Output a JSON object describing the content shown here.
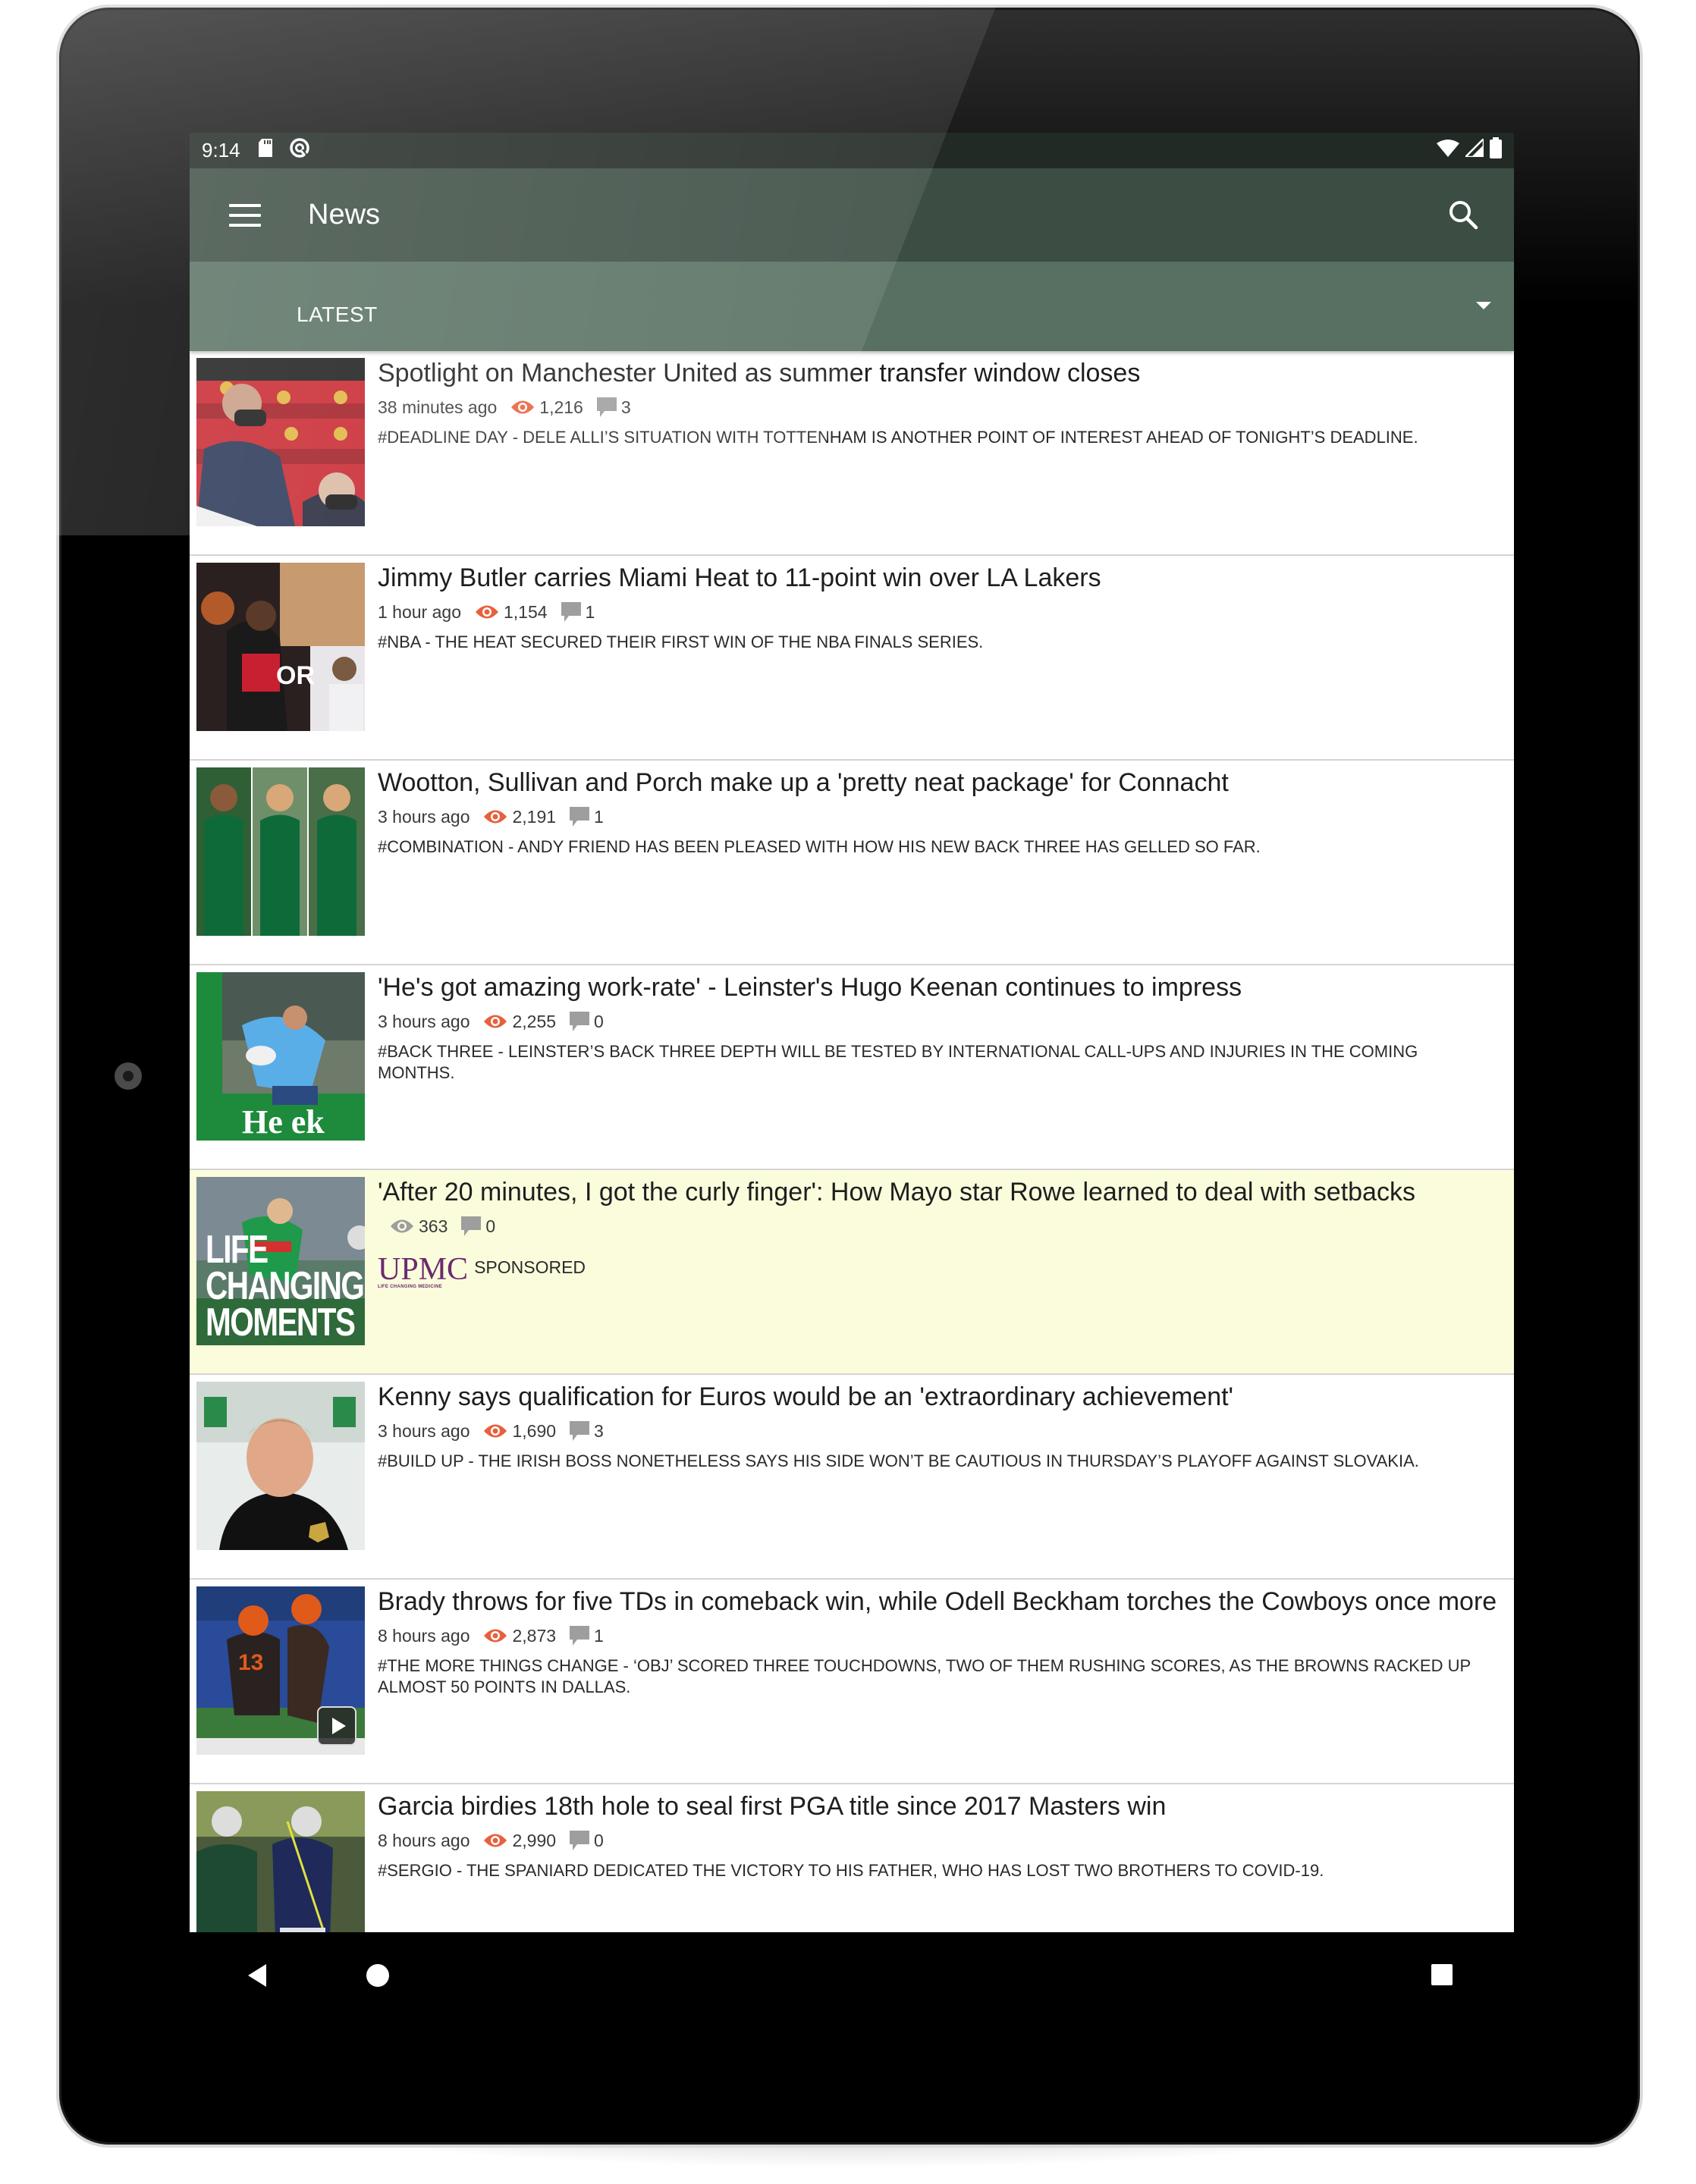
{
  "status_bar": {
    "time": "9:14",
    "left_icons": [
      "sd-card-icon",
      "data-saver-icon"
    ],
    "right_icons": [
      "wifi-icon",
      "cell-signal-icon",
      "battery-icon"
    ]
  },
  "toolbar": {
    "title": "News",
    "menu_icon": "hamburger-menu-icon",
    "search_icon": "search-icon"
  },
  "tab_strip": {
    "selected": "LATEST",
    "dropdown_icon": "dropdown-arrow-icon"
  },
  "colors": {
    "status_bar": "#222a25",
    "toolbar": "#3c4d43",
    "tab_strip": "#577061",
    "views_icon": "#e8603c",
    "comments_icon": "#9e9e9e",
    "sponsored_bg": "#fafcdc",
    "sponsor_brand": "#6b2a6e"
  },
  "articles": [
    {
      "headline": "Spotlight on Manchester United as summer transfer window closes",
      "time_ago": "38 minutes ago",
      "views": "1,216",
      "comments": "3",
      "tagline": "#DEADLINE DAY - DELE ALLI’S SITUATION WITH TOTTENHAM IS ANOTHER POINT OF INTEREST AHEAD OF TONIGHT’S DEADLINE.",
      "thumbnail": "man-utd-executives-in-stands-photo"
    },
    {
      "headline": "Jimmy Butler carries Miami Heat to 11-point win over LA Lakers",
      "time_ago": "1 hour ago",
      "views": "1,154",
      "comments": "1",
      "tagline": "#NBA - THE HEAT SECURED THEIR FIRST WIN OF THE NBA FINALS SERIES.",
      "thumbnail": "jimmy-butler-basketball-photo"
    },
    {
      "headline": "Wootton, Sullivan and Porch make up a 'pretty neat package' for Connacht",
      "time_ago": "3 hours ago",
      "views": "2,191",
      "comments": "1",
      "tagline": "#COMBINATION - ANDY FRIEND HAS BEEN PLEASED WITH HOW HIS NEW BACK THREE HAS GELLED SO FAR.",
      "thumbnail": "connacht-players-collage-photo"
    },
    {
      "headline": "'He's got amazing work-rate' - Leinster's Hugo Keenan continues to impress",
      "time_ago": "3 hours ago",
      "views": "2,255",
      "comments": "0",
      "tagline": "#BACK THREE - LEINSTER’S BACK THREE DEPTH WILL BE TESTED BY INTERNATIONAL CALL-UPS AND INJURIES IN THE COMING MONTHS.",
      "thumbnail": "hugo-keenan-rugby-photo"
    },
    {
      "sponsored": true,
      "headline": "'After 20 minutes, I got the curly finger': How Mayo star Rowe learned to deal with setbacks",
      "views": "363",
      "comments": "0",
      "sponsor_name": "UPMC",
      "sponsor_subtitle": "LIFE CHANGING MEDICINE",
      "sponsored_label": "SPONSORED",
      "thumbnail": "life-changing-moments-ad-photo",
      "thumbnail_text": [
        "LIFE",
        "CHANGING",
        "MOMENTS"
      ]
    },
    {
      "headline": "Kenny says qualification for Euros would be an 'extraordinary achievement'",
      "time_ago": "3 hours ago",
      "views": "1,690",
      "comments": "3",
      "tagline": "#BUILD UP - THE IRISH BOSS NONETHELESS SAYS HIS SIDE WON’T BE CAUTIOUS IN THURSDAY’S PLAYOFF AGAINST SLOVAKIA.",
      "thumbnail": "stephen-kenny-portrait-photo"
    },
    {
      "headline": "Brady throws for five TDs in comeback win, while Odell Beckham torches the Cowboys once more",
      "time_ago": "8 hours ago",
      "views": "2,873",
      "comments": "1",
      "tagline": "#THE MORE THINGS CHANGE - ‘OBJ’ SCORED THREE TOUCHDOWNS, TWO OF THEM RUSHING SCORES, AS THE BROWNS RACKED UP ALMOST 50 POINTS IN DALLAS.",
      "thumbnail": "browns-players-celebrating-photo",
      "has_video": true
    },
    {
      "headline": "Garcia birdies 18th hole to seal first PGA title since 2017 Masters win",
      "time_ago": "8 hours ago",
      "views": "2,990",
      "comments": "0",
      "tagline": "#SERGIO - THE SPANIARD DEDICATED THE VICTORY TO HIS FATHER, WHO HAS LOST TWO BROTHERS TO COVID-19.",
      "thumbnail": "sergio-garcia-golf-photo"
    }
  ],
  "nav_bar": {
    "back": "back-icon",
    "home": "home-icon",
    "recents": "recents-icon"
  }
}
